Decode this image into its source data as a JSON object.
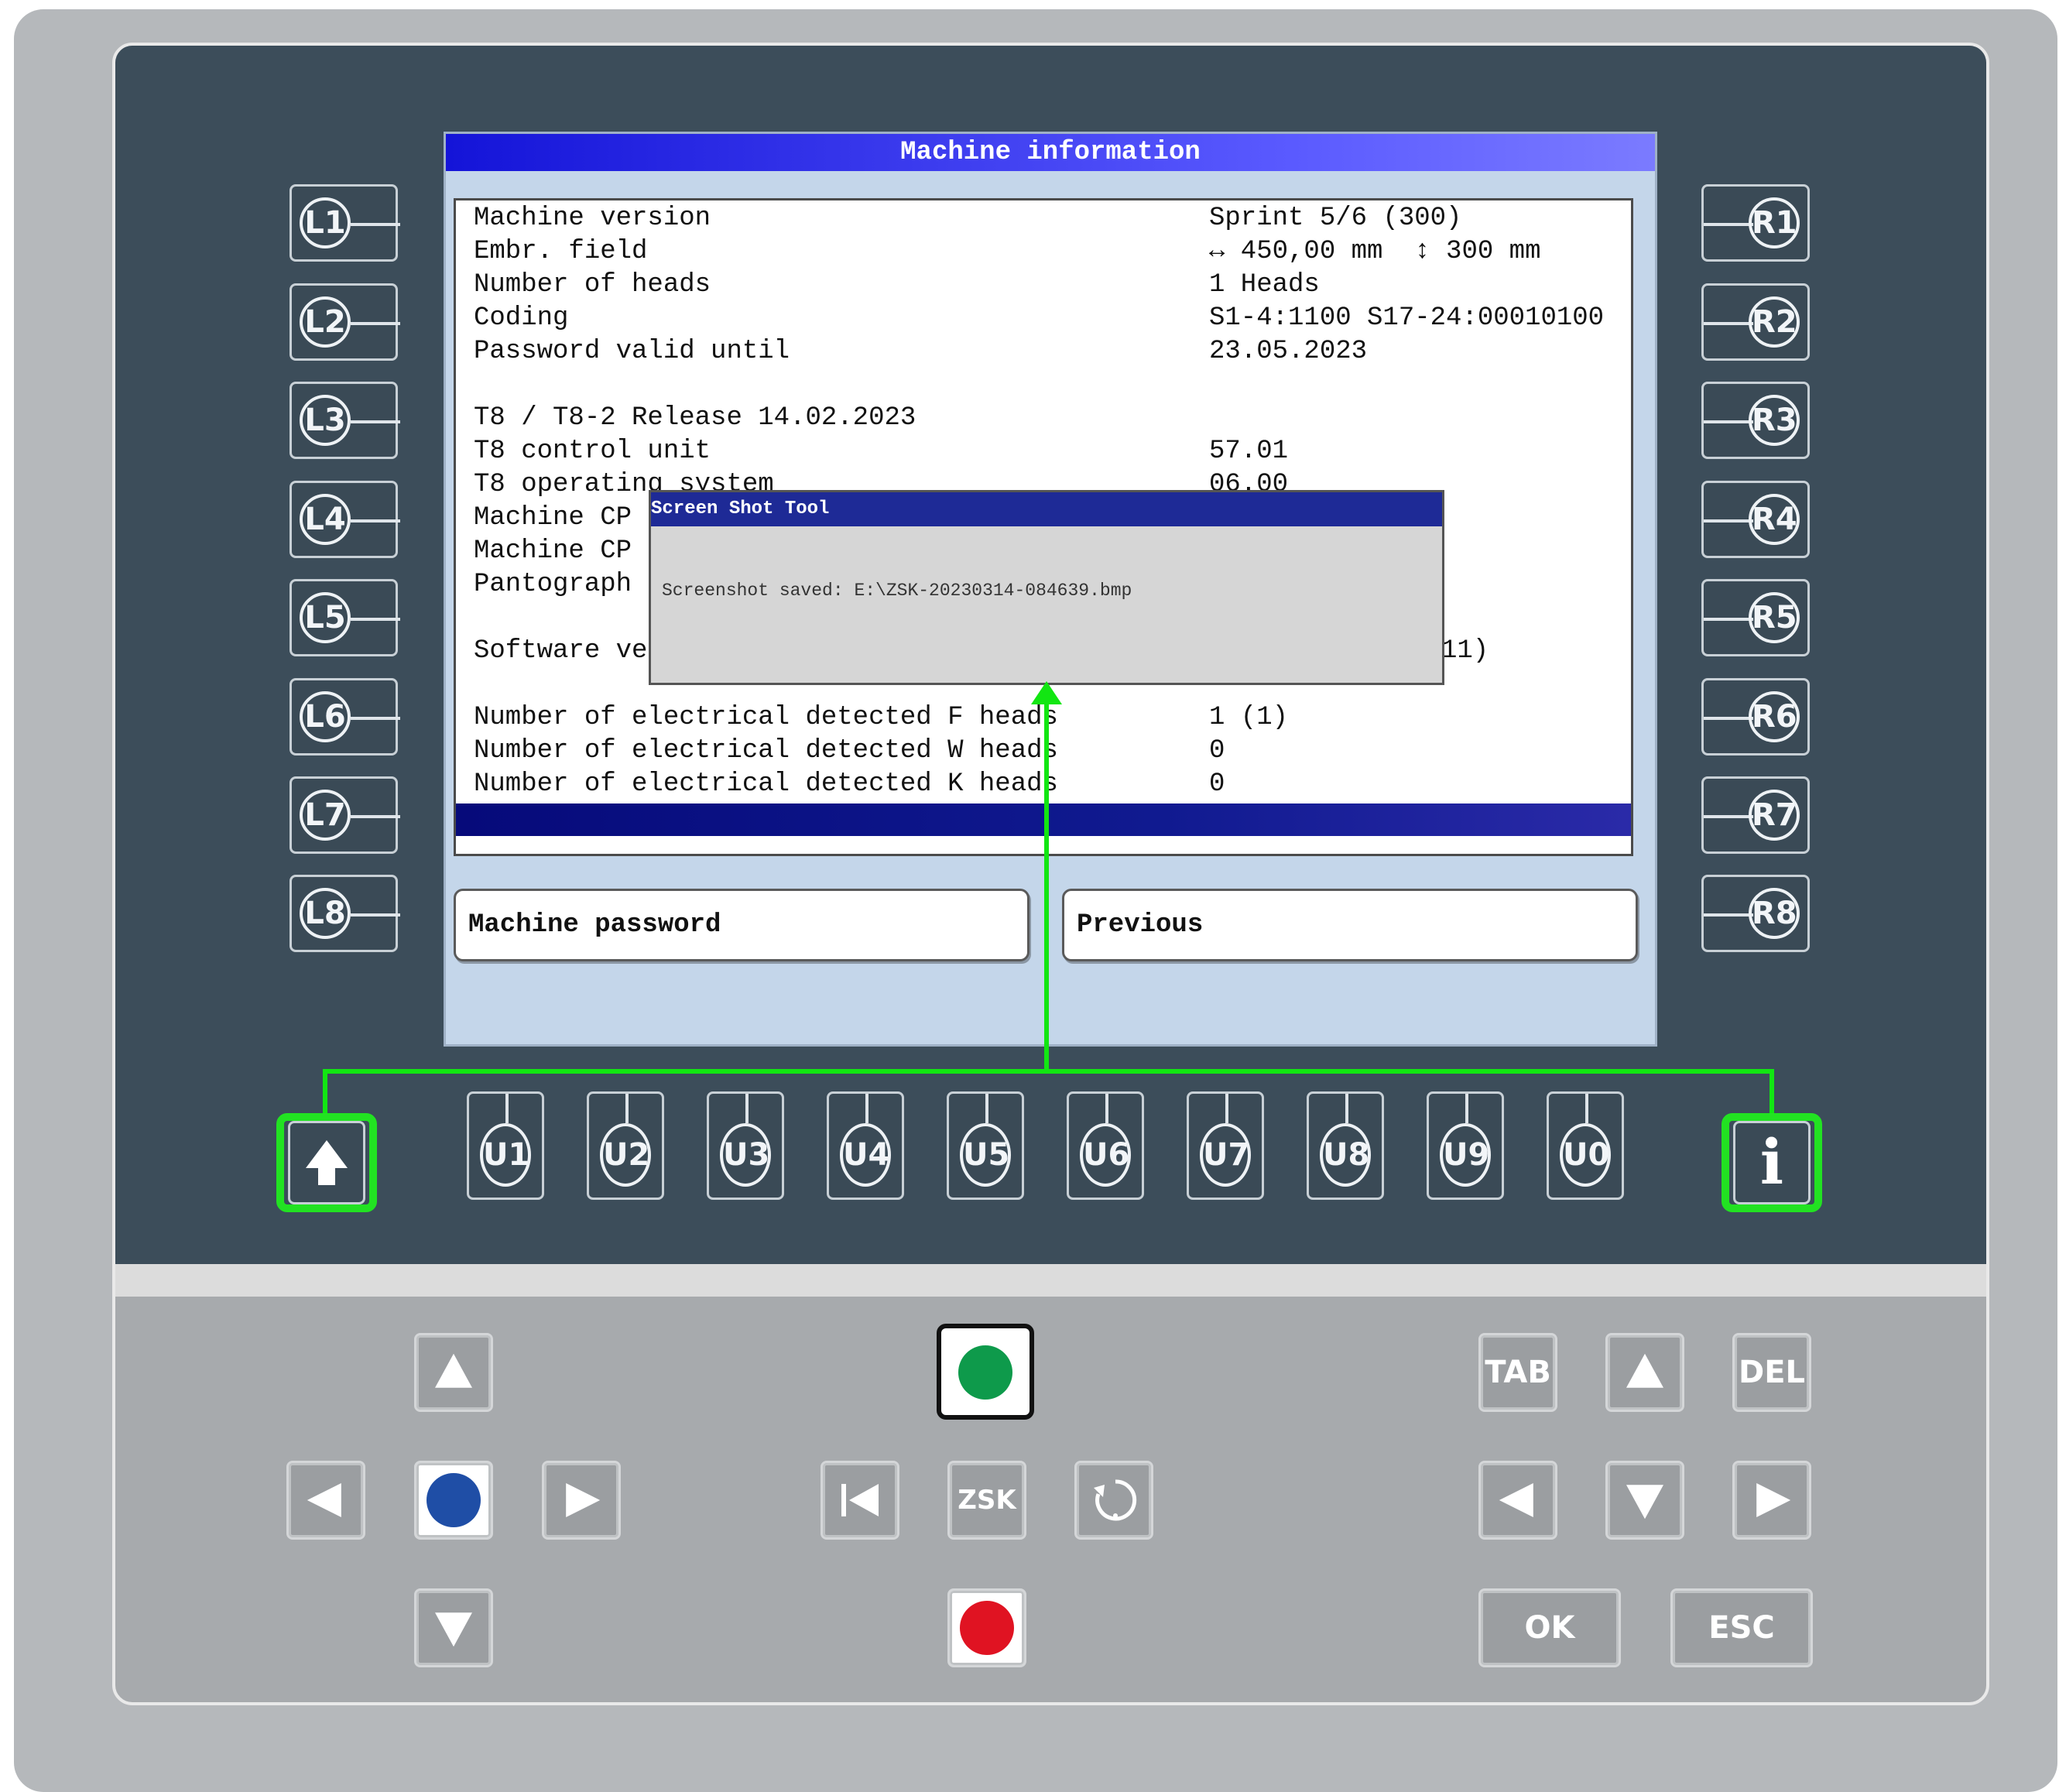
{
  "screen": {
    "title": "Machine information",
    "rows": [
      {
        "label": "Machine version",
        "value": "Sprint 5/6 (300)"
      },
      {
        "label": "Embr. field",
        "value": "↔ 450,00 mm  ↕ 300 mm"
      },
      {
        "label": "Number of heads",
        "value": "1 Heads"
      },
      {
        "label": "Coding",
        "value": "S1-4:1100 S17-24:00010100"
      },
      {
        "label": "Password valid until",
        "value": "23.05.2023"
      },
      {
        "label": "T8 / T8-2 Release 14.02.2023",
        "value": ""
      },
      {
        "label": "T8 control unit",
        "value": "57.01"
      },
      {
        "label": "T8 operating system",
        "value": "06.00"
      },
      {
        "label": "Machine CP",
        "value": ""
      },
      {
        "label": "Machine CP",
        "value": ""
      },
      {
        "label": "Pantograph",
        "value": ""
      },
      {
        "label": "Software ve",
        "value": "11)"
      },
      {
        "label": "Number of electrical detected F heads",
        "value": "1 (1)"
      },
      {
        "label": "Number of electrical detected W heads",
        "value": "0"
      },
      {
        "label": "Number of electrical detected K heads",
        "value": "0"
      }
    ],
    "softkeys": {
      "left": "Machine password",
      "right": "Previous"
    }
  },
  "dialog": {
    "title": "Screen Shot Tool",
    "message": "Screenshot saved: E:\\ZSK-20230314-084639.bmp"
  },
  "keys": {
    "left": [
      "L1",
      "L2",
      "L3",
      "L4",
      "L5",
      "L6",
      "L7",
      "L8"
    ],
    "right": [
      "R1",
      "R2",
      "R3",
      "R4",
      "R5",
      "R6",
      "R7",
      "R8"
    ],
    "bottom": [
      "U1",
      "U2",
      "U3",
      "U4",
      "U5",
      "U6",
      "U7",
      "U8",
      "U9",
      "U0"
    ],
    "info": "i",
    "tab": "TAB",
    "del": "DEL",
    "ok": "OK",
    "esc": "ESC",
    "brand": "ZSK"
  },
  "icons": {
    "shift": "up-arrow-icon",
    "info": "info-icon",
    "start": "green-start-icon",
    "stop": "red-stop-icon",
    "center": "blue-dot-icon",
    "home": "skip-to-start-icon",
    "rotate": "rotate-icon"
  },
  "colors": {
    "highlight": "#22e222",
    "title_bar": "#1414d8",
    "panel": "#3c4d5a",
    "start": "#0e9a4b",
    "stop": "#e01322",
    "center": "#1f4ea6"
  }
}
